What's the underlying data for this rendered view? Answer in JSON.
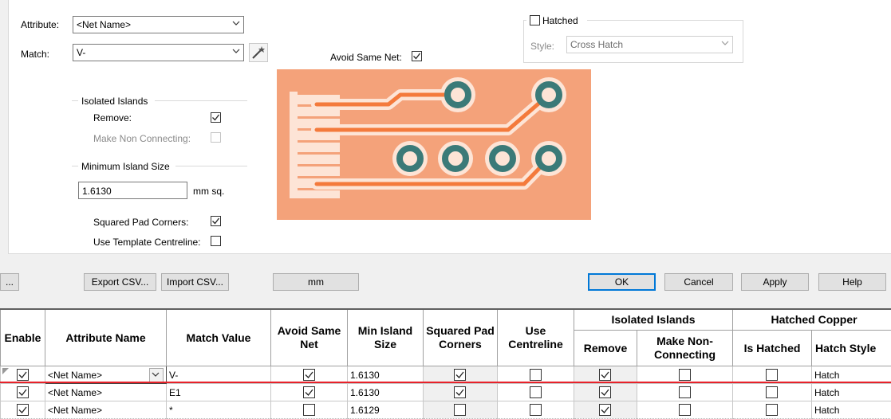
{
  "attribute": {
    "label": "Attribute:",
    "value": "<Net Name>"
  },
  "match": {
    "label": "Match:",
    "value": "V-"
  },
  "avoid_same_net": {
    "label": "Avoid Same Net:",
    "checked": true
  },
  "hatched": {
    "label": "Hatched",
    "checked": false,
    "style_label": "Style:",
    "style_value": "Cross Hatch"
  },
  "isolated_islands": {
    "title": "Isolated Islands",
    "remove_label": "Remove:",
    "remove_checked": true,
    "make_nc_label": "Make Non Connecting:",
    "make_nc_checked": false
  },
  "min_island": {
    "title": "Minimum Island Size",
    "value": "1.6130",
    "unit": "mm sq."
  },
  "squared_pad_corners": {
    "label": "Squared Pad Corners:",
    "checked": true
  },
  "use_template_centreline": {
    "label": "Use Template Centreline:",
    "checked": false
  },
  "buttons": {
    "ellipsis": "...",
    "export_csv": "Export CSV...",
    "import_csv": "Import CSV...",
    "units": "mm",
    "ok": "OK",
    "cancel": "Cancel",
    "apply": "Apply",
    "help": "Help"
  },
  "table": {
    "headers": {
      "enable": "Enable",
      "attribute_name": "Attribute Name",
      "match_value": "Match Value",
      "avoid_same_net": "Avoid Same Net",
      "min_island_size": "Min Island Size",
      "squared_pad_corners": "Squared Pad Corners",
      "use_centreline": "Use Centreline",
      "isolated_islands": "Isolated Islands",
      "remove": "Remove",
      "make_non_connecting": "Make Non-Connecting",
      "hatched_copper": "Hatched Copper",
      "is_hatched": "Is Hatched",
      "hatch_style": "Hatch Style"
    },
    "rows": [
      {
        "enable": true,
        "attribute": "<Net Name>",
        "match": "V-",
        "avoid": true,
        "min_island": "1.6130",
        "squared": true,
        "centreline": false,
        "remove": true,
        "make_nc": false,
        "is_hatched": false,
        "hatch_style": "Hatch"
      },
      {
        "enable": true,
        "attribute": "<Net Name>",
        "match": "E1",
        "avoid": true,
        "min_island": "1.6130",
        "squared": true,
        "centreline": false,
        "remove": true,
        "make_nc": false,
        "is_hatched": false,
        "hatch_style": "Hatch"
      },
      {
        "enable": true,
        "attribute": "<Net Name>",
        "match": "*",
        "avoid": false,
        "min_island": "1.6129",
        "squared": false,
        "centreline": false,
        "remove": true,
        "make_nc": false,
        "is_hatched": false,
        "hatch_style": "Hatch"
      }
    ]
  },
  "colors": {
    "preview_bg": "#f4a27a",
    "trace": "#f47a3c",
    "pad": "#3b7a78",
    "accent": "#0078d7",
    "selection_line": "#e8222a"
  }
}
